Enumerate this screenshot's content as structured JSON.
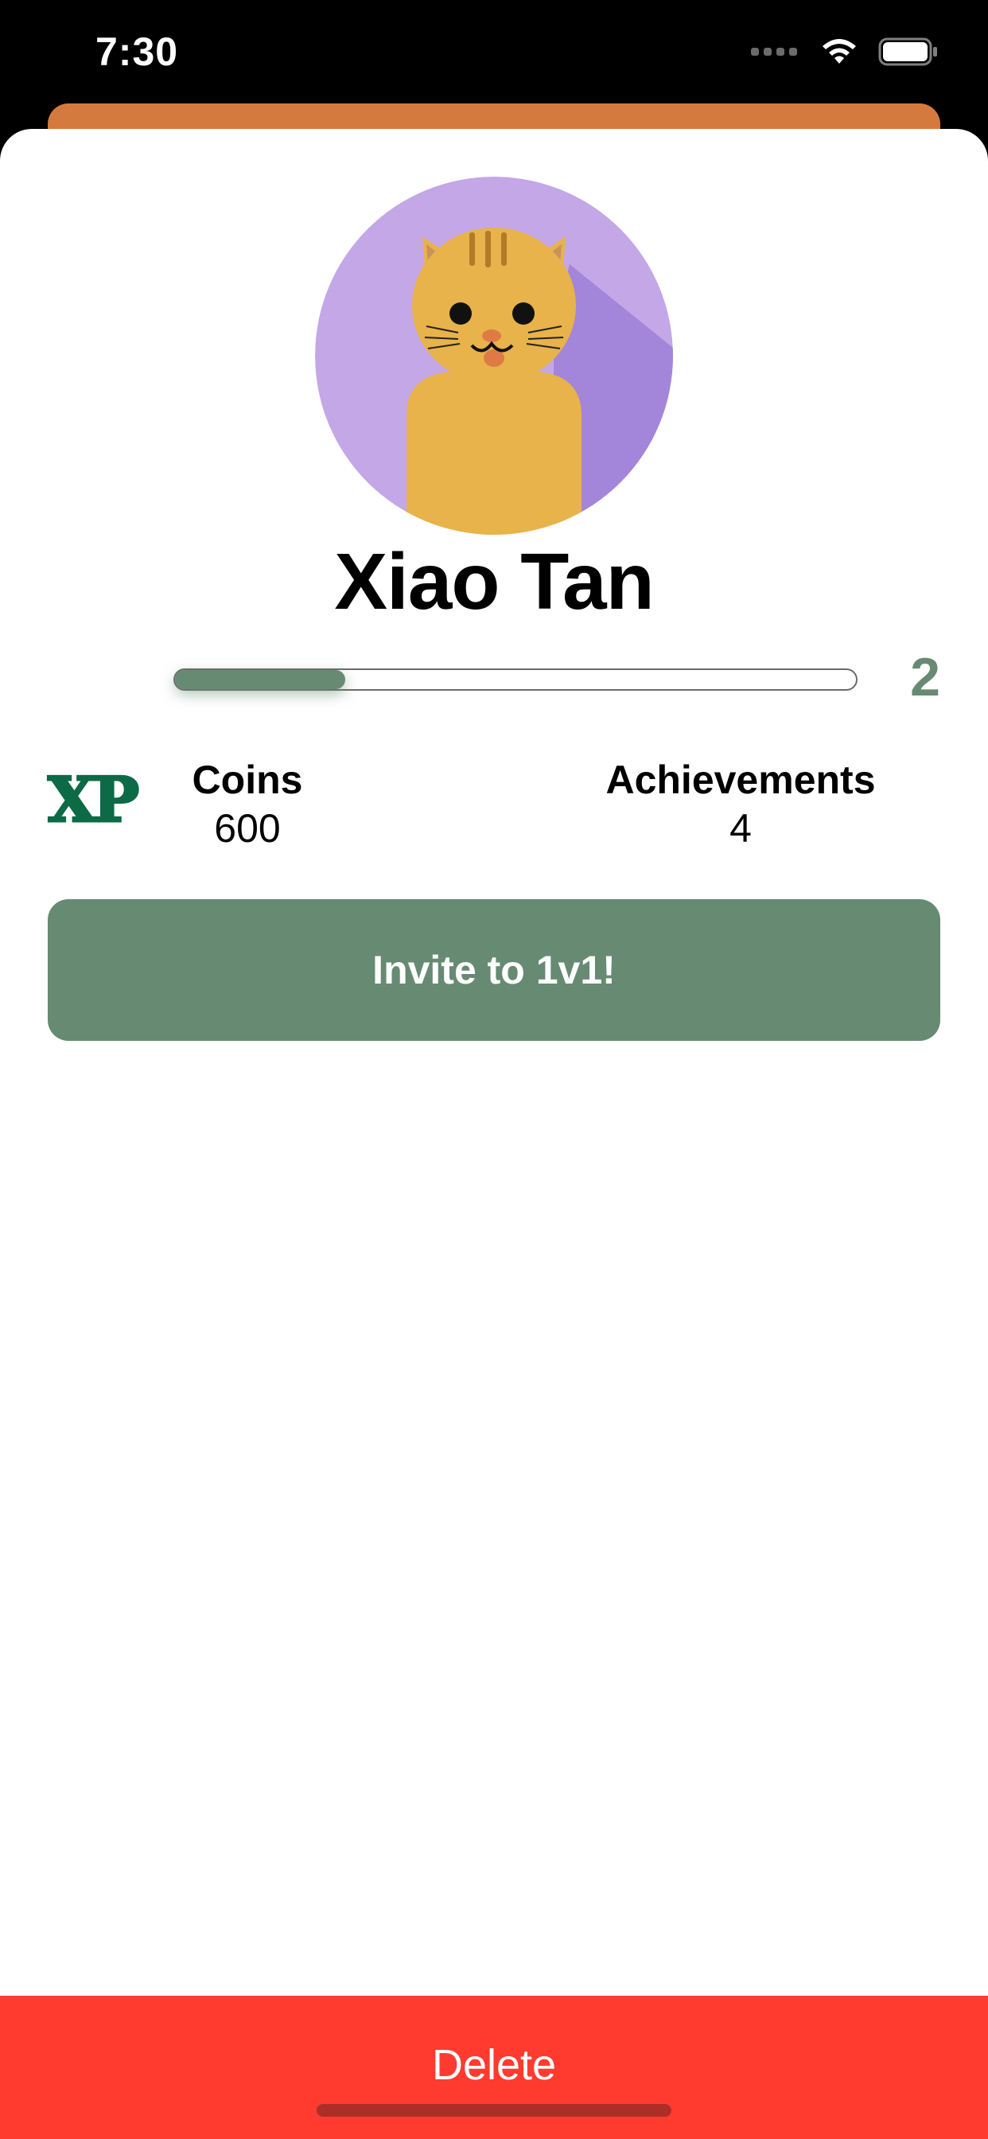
{
  "status_bar": {
    "time": "7:30",
    "signal_icon": "signal-dots-icon",
    "wifi_icon": "wifi-icon",
    "battery_icon": "battery-icon"
  },
  "profile": {
    "avatar_icon": "cat-avatar-icon",
    "name": "Xiao Tan"
  },
  "xp": {
    "logo": "XP",
    "progress": 0.25,
    "level": "2"
  },
  "stats": {
    "coins_label": "Coins",
    "coins_value": "600",
    "achievements_label": "Achievements",
    "achievements_value": "4"
  },
  "actions": {
    "invite_label": "Invite to 1v1!",
    "delete_label": "Delete"
  },
  "colors": {
    "accent_green": "#678a73",
    "xp_logo_green": "#0c6a47",
    "delete_red": "#ff3b30",
    "behind_sheet_orange": "#d57a3e",
    "avatar_background": "#c4a7e7"
  }
}
